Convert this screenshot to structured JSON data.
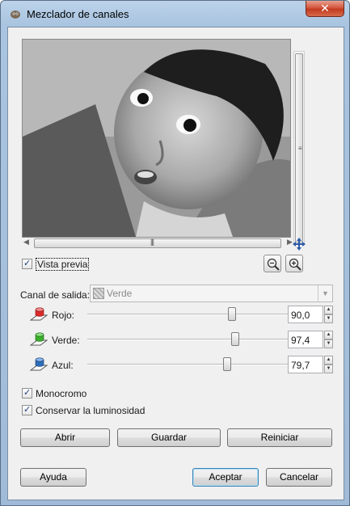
{
  "window": {
    "title": "Mezclador de canales",
    "close_glyph": "✕"
  },
  "preview": {
    "checkbox_label": "Vista previa",
    "checked": true,
    "zoom_out_icon": "zoom-out-icon",
    "zoom_in_icon": "zoom-in-icon",
    "navigate_icon": "navigate-icon"
  },
  "output_channel": {
    "label": "Canal de salida:",
    "value": "Verde"
  },
  "sliders": [
    {
      "label": "Rojo:",
      "value": "90,0",
      "color": "#d92b2b",
      "level": 0.763
    },
    {
      "label": "Verde:",
      "value": "97,4",
      "color": "#3cae2e",
      "level": 0.785
    },
    {
      "label": "Azul:",
      "value": "79,7",
      "color": "#2e6db8",
      "level": 0.735
    }
  ],
  "options": [
    {
      "label": "Monocromo",
      "checked": true
    },
    {
      "label": "Conservar la luminosidad",
      "checked": true
    }
  ],
  "actions": {
    "open": "Abrir",
    "save": "Guardar",
    "reset": "Reiniciar"
  },
  "footer": {
    "help": "Ayuda",
    "ok": "Aceptar",
    "cancel": "Cancelar"
  }
}
